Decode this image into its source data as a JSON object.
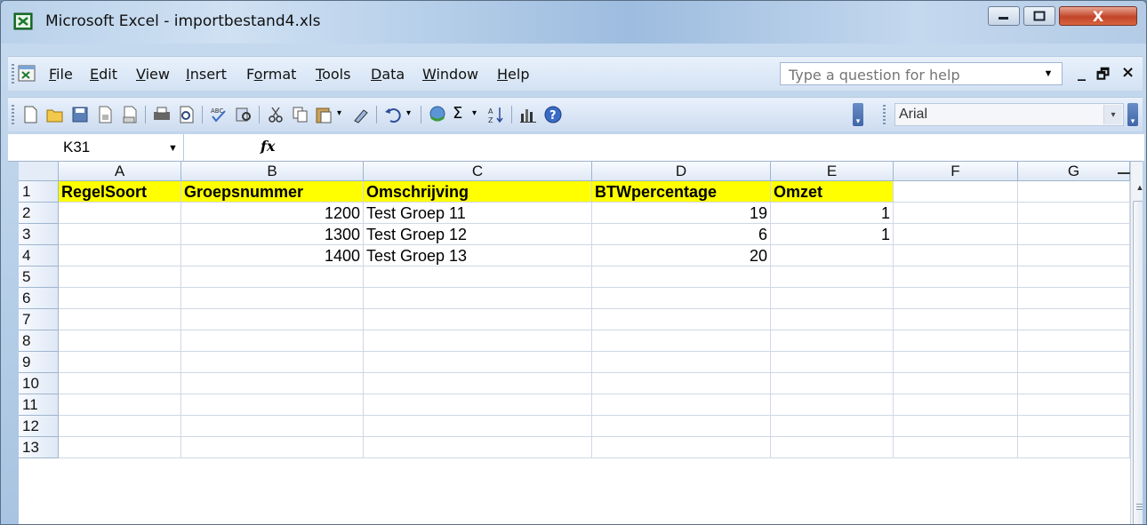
{
  "window": {
    "title": "Microsoft Excel - importbestand4.xls",
    "controls": {
      "minimize": "—",
      "maximize": "□",
      "close": "X"
    }
  },
  "menu": {
    "items": [
      {
        "key": "F",
        "rest": "ile"
      },
      {
        "key": "E",
        "rest": "dit"
      },
      {
        "key": "V",
        "rest": "iew"
      },
      {
        "key": "I",
        "rest": "nsert"
      },
      {
        "pre": "F",
        "key": "o",
        "rest": "rmat"
      },
      {
        "key": "T",
        "rest": "ools"
      },
      {
        "key": "D",
        "rest": "ata"
      },
      {
        "key": "W",
        "rest": "indow"
      },
      {
        "key": "H",
        "rest": "elp"
      }
    ],
    "help_placeholder": "Type a question for help",
    "doc_controls": [
      "_",
      "🗗",
      "×"
    ]
  },
  "toolbar": {
    "font_name": "Arial",
    "icons": [
      "new-icon",
      "open-icon",
      "save-icon",
      "permission-icon",
      "email-icon",
      "print-icon",
      "print-preview-icon",
      "spelling-icon",
      "research-icon",
      "cut-icon",
      "copy-icon",
      "paste-icon",
      "format-painter-icon",
      "undo-icon",
      "hyperlink-icon",
      "autosum-icon",
      "sort-ascending-icon",
      "chart-wizard-icon",
      "help-icon"
    ]
  },
  "formula_bar": {
    "name_box": "K31",
    "fx_label": "fx",
    "formula": ""
  },
  "sheet": {
    "columns": [
      "A",
      "B",
      "C",
      "D",
      "E",
      "F",
      "G"
    ],
    "rows": [
      "1",
      "2",
      "3",
      "4",
      "5",
      "6",
      "7",
      "8",
      "9",
      "10",
      "11",
      "12",
      "13"
    ],
    "header_row": [
      "RegelSoort",
      "Groepsnummer",
      "Omschrijving",
      "BTWpercentage",
      "Omzet"
    ],
    "data": [
      [
        "",
        "1200",
        "Test Groep 11",
        "19",
        "1"
      ],
      [
        "",
        "1300",
        "Test Groep 12",
        "6",
        "1"
      ],
      [
        "",
        "1400",
        "Test Groep 13",
        "20",
        ""
      ]
    ]
  }
}
